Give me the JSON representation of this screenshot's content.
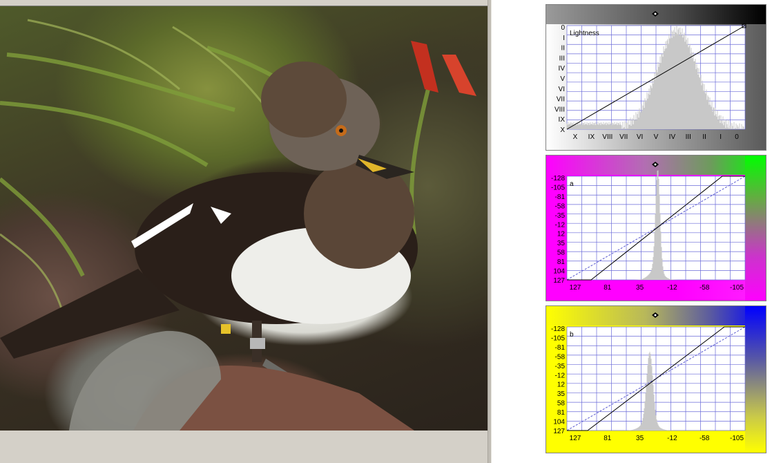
{
  "photo": {
    "subject": "hooded merganser duck on rock"
  },
  "panels": {
    "lightness": {
      "label": "Lightness",
      "y_ticks": [
        "0",
        "I",
        "II",
        "III",
        "IV",
        "V",
        "VI",
        "VII",
        "VIII",
        "IX",
        "X"
      ],
      "x_ticks": [
        "X",
        "IX",
        "VIII",
        "VII",
        "VI",
        "V",
        "IV",
        "III",
        "II",
        "I",
        "0"
      ],
      "colors": {
        "grid": "#6a6ad8",
        "histogram": "#c8c8c8",
        "curve": "#000000"
      }
    },
    "a": {
      "label": "a",
      "y_ticks": [
        "-128",
        "-105",
        "-81",
        "-58",
        "-35",
        "-12",
        "12",
        "35",
        "58",
        "81",
        "104",
        "127"
      ],
      "x_ticks": [
        "127",
        "81",
        "35",
        "-12",
        "-58",
        "-105"
      ],
      "colors": {
        "grid": "#6a6ad8",
        "histogram": "#c8c8c8",
        "curve": "#000000",
        "diagonal": "#5a5ad0"
      }
    },
    "b": {
      "label": "b",
      "y_ticks": [
        "-128",
        "-105",
        "-81",
        "-58",
        "-35",
        "-12",
        "12",
        "35",
        "58",
        "81",
        "104",
        "127"
      ],
      "x_ticks": [
        "127",
        "81",
        "35",
        "-12",
        "-58",
        "-105"
      ],
      "colors": {
        "grid": "#6a6ad8",
        "histogram": "#c8c8c8",
        "curve": "#000000",
        "diagonal": "#5a5ad0"
      }
    }
  },
  "icons": {
    "handle": "eye-handle-icon"
  }
}
